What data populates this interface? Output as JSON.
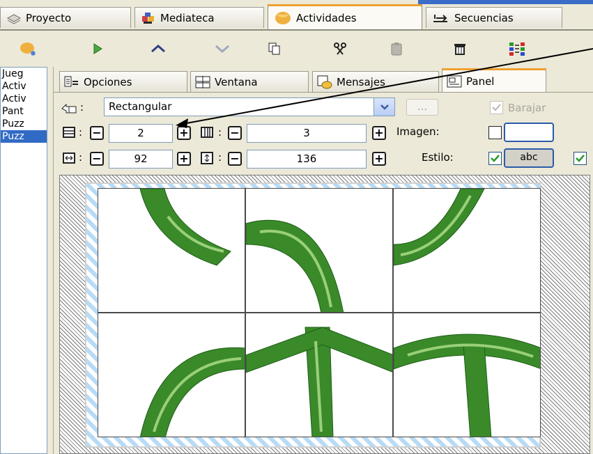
{
  "top_tabs": [
    {
      "label": "Proyecto",
      "icon": "project-icon"
    },
    {
      "label": "Mediateca",
      "icon": "media-icon"
    },
    {
      "label": "Actividades",
      "icon": "activities-icon"
    },
    {
      "label": "Secuencias",
      "icon": "sequences-icon"
    }
  ],
  "toolbar": [
    "new-activity-icon",
    "play-icon",
    "move-up-icon",
    "move-down-icon",
    "copy-icon",
    "cut-icon",
    "paste-icon",
    "delete-icon",
    "arrange-icon"
  ],
  "activity_list": [
    {
      "label": "Jueg",
      "selected": false
    },
    {
      "label": "Activ",
      "selected": false
    },
    {
      "label": "Activ",
      "selected": false
    },
    {
      "label": "Pant",
      "selected": false
    },
    {
      "label": "Puzz",
      "selected": false
    },
    {
      "label": "Puzz",
      "selected": true
    }
  ],
  "sub_tabs": [
    {
      "label": "Opciones",
      "icon": "options-icon"
    },
    {
      "label": "Ventana",
      "icon": "window-icon"
    },
    {
      "label": "Mensajes",
      "icon": "messages-icon"
    },
    {
      "label": "Panel",
      "icon": "panel-icon"
    }
  ],
  "panel": {
    "shape_label": ":",
    "shape_value": "Rectangular",
    "dots_label": "...",
    "shuffle_label": "Barajar",
    "rows": "2",
    "cols": "3",
    "cell_width": "92",
    "cell_height": "136",
    "image_label": "Imagen:",
    "style_label": "Estilo:",
    "style_value": "abc",
    "colon": ":"
  },
  "colors": {
    "accent_tab": "#f0a030",
    "selection": "#316ac5",
    "puzzle_green": "#3a8a2a"
  }
}
